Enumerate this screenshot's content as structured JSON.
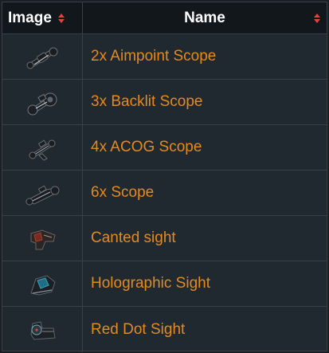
{
  "table": {
    "columns": [
      {
        "label": "Image"
      },
      {
        "label": "Name"
      }
    ],
    "rows": [
      {
        "name": "2x Aimpoint Scope",
        "icon": "scope-icon"
      },
      {
        "name": "3x Backlit Scope",
        "icon": "scope-icon"
      },
      {
        "name": "4x ACOG Scope",
        "icon": "scope-icon"
      },
      {
        "name": "6x Scope",
        "icon": "scope-icon"
      },
      {
        "name": "Canted sight",
        "icon": "sight-icon"
      },
      {
        "name": "Holographic Sight",
        "icon": "sight-icon"
      },
      {
        "name": "Red Dot Sight",
        "icon": "sight-icon"
      }
    ]
  },
  "colors": {
    "link": "#e58a1f",
    "sort_arrow": "#e0453a",
    "header_bg": "#12171c",
    "row_bg": "#202830"
  }
}
